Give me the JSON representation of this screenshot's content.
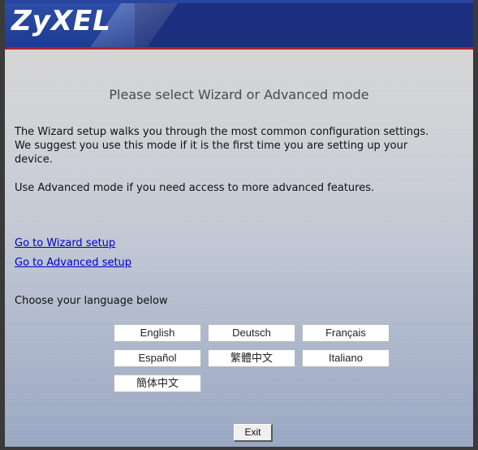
{
  "header": {
    "logo_text": "ZyXEL",
    "colors": {
      "banner": "#1b2f7e",
      "accent_line": "#a7242b"
    }
  },
  "main": {
    "title": "Please select Wizard or Advanced mode",
    "wizard_description_lines": [
      "The Wizard setup walks you through the most common configuration settings.",
      "We suggest you use this mode if it is the first time you are setting up your",
      "device."
    ],
    "advanced_description": "Use Advanced mode if you need access to more advanced features.",
    "links": {
      "wizard": "Go to Wizard setup",
      "advanced": "Go to Advanced setup"
    },
    "language_prompt": "Choose your language below",
    "languages": [
      "English",
      "Deutsch",
      "Français",
      "Español",
      "繁體中文",
      "Italiano",
      "簡体中文"
    ],
    "exit_label": "Exit"
  }
}
